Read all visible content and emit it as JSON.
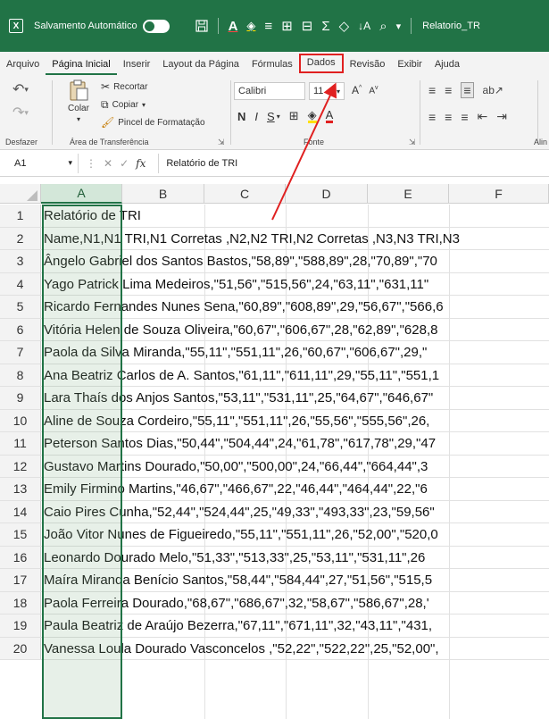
{
  "titlebar": {
    "autosave_label": "Salvamento Automático",
    "toggle_state": "Desativado",
    "filename": "Relatorio_TR"
  },
  "tabs": [
    {
      "label": "Arquivo"
    },
    {
      "label": "Página Inicial"
    },
    {
      "label": "Inserir"
    },
    {
      "label": "Layout da Página"
    },
    {
      "label": "Fórmulas"
    },
    {
      "label": "Dados"
    },
    {
      "label": "Revisão"
    },
    {
      "label": "Exibir"
    },
    {
      "label": "Ajuda"
    }
  ],
  "ribbon": {
    "clipboard": {
      "cut": "Recortar",
      "copy": "Copiar",
      "paste": "Colar",
      "format_painter": "Pincel de Formatação",
      "group_label": "Área de Transferência"
    },
    "undo_group_label": "Desfazer",
    "font": {
      "name": "Calibri",
      "size": "11",
      "group_label": "Fonte",
      "bold": "N",
      "italic": "I",
      "underline": "S"
    },
    "align_group_label": "Alin"
  },
  "formula_bar": {
    "name_box": "A1",
    "content": "Relatório de TRI"
  },
  "columns": [
    "A",
    "B",
    "C",
    "D",
    "E",
    "F"
  ],
  "selected_column": "A",
  "rows": [
    {
      "n": "1",
      "text": "Relatório de TRI"
    },
    {
      "n": "2",
      "text": "Name,N1,N1 TRI,N1 Corretas ,N2,N2 TRI,N2 Corretas ,N3,N3 TRI,N3"
    },
    {
      "n": "3",
      "text": "Ângelo Gabriel dos Santos Bastos,\"58,89\",\"588,89\",28,\"70,89\",\"70"
    },
    {
      "n": "4",
      "text": "Yago Patrick Lima Medeiros,\"51,56\",\"515,56\",24,\"63,11\",\"631,11\""
    },
    {
      "n": "5",
      "text": "Ricardo Fernandes Nunes Sena,\"60,89\",\"608,89\",29,\"56,67\",\"566,6"
    },
    {
      "n": "6",
      "text": "Vitória Helen de Souza Oliveira,\"60,67\",\"606,67\",28,\"62,89\",\"628,8"
    },
    {
      "n": "7",
      "text": "Paola da Silva Miranda,\"55,11\",\"551,11\",26,\"60,67\",\"606,67\",29,\""
    },
    {
      "n": "8",
      "text": "Ana Beatriz Carlos de A. Santos,\"61,11\",\"611,11\",29,\"55,11\",\"551,1"
    },
    {
      "n": "9",
      "text": "Lara Thaís dos Anjos Santos,\"53,11\",\"531,11\",25,\"64,67\",\"646,67\""
    },
    {
      "n": "10",
      "text": "Aline de Souza Cordeiro,\"55,11\",\"551,11\",26,\"55,56\",\"555,56\",26,"
    },
    {
      "n": "11",
      "text": "Peterson Santos Dias,\"50,44\",\"504,44\",24,\"61,78\",\"617,78\",29,\"47"
    },
    {
      "n": "12",
      "text": "Gustavo Martins Dourado,\"50,00\",\"500,00\",24,\"66,44\",\"664,44\",3"
    },
    {
      "n": "13",
      "text": "Emily Firmino Martins,\"46,67\",\"466,67\",22,\"46,44\",\"464,44\",22,\"6"
    },
    {
      "n": "14",
      "text": "Caio Pires Cunha,\"52,44\",\"524,44\",25,\"49,33\",\"493,33\",23,\"59,56\""
    },
    {
      "n": "15",
      "text": "João Vitor Nunes de Figueiredo,\"55,11\",\"551,11\",26,\"52,00\",\"520,0"
    },
    {
      "n": "16",
      "text": "Leonardo Dourado Melo,\"51,33\",\"513,33\",25,\"53,11\",\"531,11\",26"
    },
    {
      "n": "17",
      "text": "Maíra Miranda Benício Santos,\"58,44\",\"584,44\",27,\"51,56\",\"515,5"
    },
    {
      "n": "18",
      "text": "Paola Ferreira Dourado,\"68,67\",\"686,67\",32,\"58,67\",\"586,67\",28,'"
    },
    {
      "n": "19",
      "text": "Paula Beatriz de Araújo Bezerra,\"67,11\",\"671,11\",32,\"43,11\",\"431,"
    },
    {
      "n": "20",
      "text": "Vanessa Loula Dourado Vasconcelos ,\"52,22\",\"522,22\",25,\"52,00\","
    }
  ],
  "colors": {
    "brand": "#217346",
    "highlight": "#e02020",
    "selection": "#d3e7d9"
  }
}
